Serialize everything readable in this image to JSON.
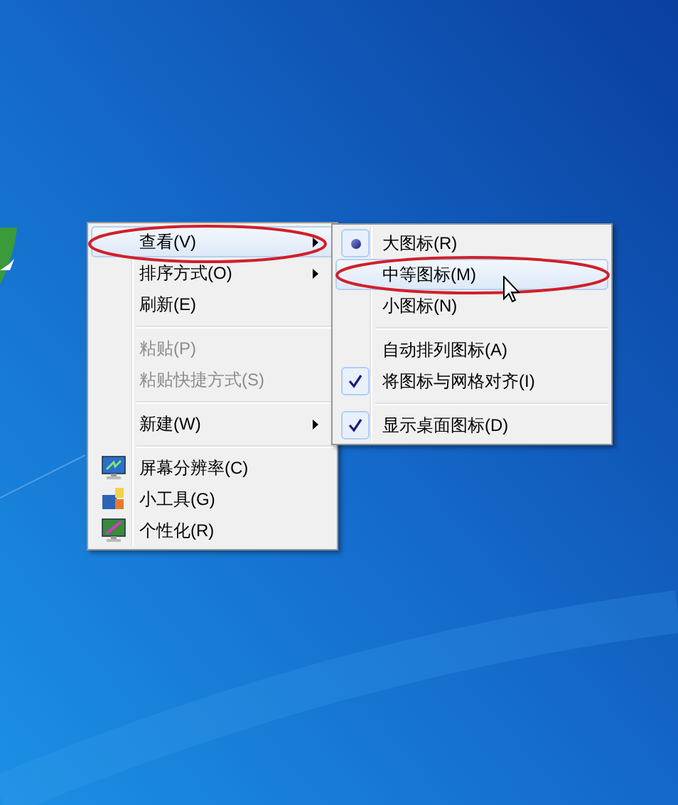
{
  "context_menu": {
    "items": [
      {
        "kind": "item",
        "label": "查看(V)",
        "highlighted": true,
        "submenu": true,
        "disabled": false
      },
      {
        "kind": "item",
        "label": "排序方式(O)",
        "highlighted": false,
        "submenu": true,
        "disabled": false
      },
      {
        "kind": "item",
        "label": "刷新(E)",
        "highlighted": false,
        "submenu": false,
        "disabled": false
      },
      {
        "kind": "separator"
      },
      {
        "kind": "item",
        "label": "粘贴(P)",
        "highlighted": false,
        "submenu": false,
        "disabled": true
      },
      {
        "kind": "item",
        "label": "粘贴快捷方式(S)",
        "highlighted": false,
        "submenu": false,
        "disabled": true
      },
      {
        "kind": "separator"
      },
      {
        "kind": "item",
        "label": "新建(W)",
        "highlighted": false,
        "submenu": true,
        "disabled": false
      },
      {
        "kind": "separator"
      },
      {
        "kind": "icon_item",
        "label": "屏幕分辨率(C)",
        "highlighted": false,
        "submenu": false,
        "disabled": false
      },
      {
        "kind": "icon_item",
        "label": "小工具(G)",
        "highlighted": false,
        "submenu": false,
        "disabled": false
      },
      {
        "kind": "icon_item",
        "label": "个性化(R)",
        "highlighted": false,
        "submenu": false,
        "disabled": false
      }
    ]
  },
  "view_submenu": {
    "items": [
      {
        "kind": "radio",
        "label": "大图标(R)",
        "checked": true,
        "highlighted": false
      },
      {
        "kind": "radio",
        "label": "中等图标(M)",
        "checked": false,
        "highlighted": true
      },
      {
        "kind": "radio",
        "label": "小图标(N)",
        "checked": false,
        "highlighted": false
      },
      {
        "kind": "separator"
      },
      {
        "kind": "check",
        "label": "自动排列图标(A)",
        "checked": false,
        "highlighted": false
      },
      {
        "kind": "check",
        "label": "将图标与网格对齐(I)",
        "checked": true,
        "highlighted": false
      },
      {
        "kind": "separator"
      },
      {
        "kind": "check",
        "label": "显示桌面图标(D)",
        "checked": true,
        "highlighted": false
      }
    ]
  }
}
